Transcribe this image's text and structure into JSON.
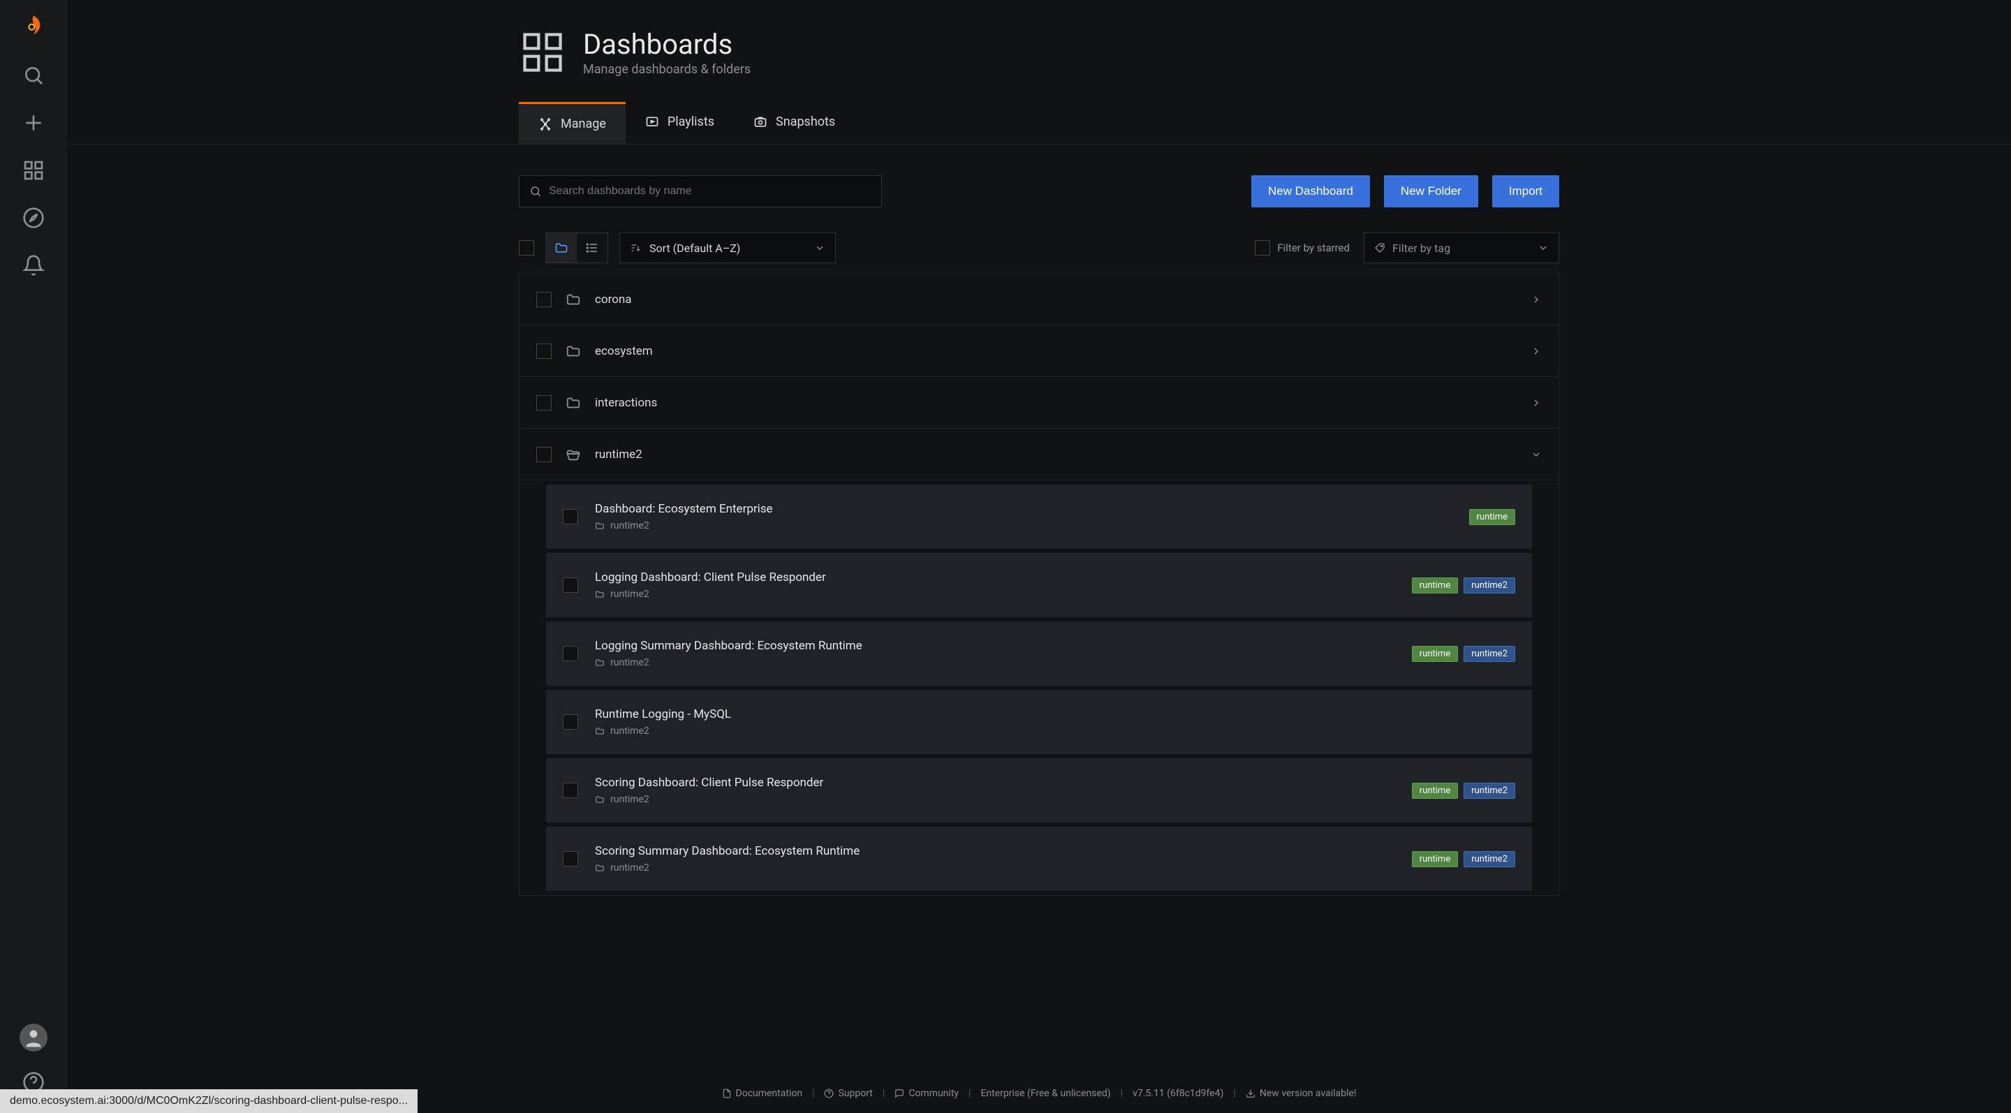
{
  "header": {
    "title": "Dashboards",
    "subtitle": "Manage dashboards & folders"
  },
  "tabs": [
    {
      "label": "Manage",
      "active": true
    },
    {
      "label": "Playlists",
      "active": false
    },
    {
      "label": "Snapshots",
      "active": false
    }
  ],
  "search": {
    "placeholder": "Search dashboards by name"
  },
  "buttons": {
    "new_dashboard": "New Dashboard",
    "new_folder": "New Folder",
    "import": "Import"
  },
  "sort": {
    "label": "Sort (Default A–Z)"
  },
  "starred": {
    "label": "Filter by starred"
  },
  "tag_filter": {
    "placeholder": "Filter by tag"
  },
  "folders": [
    {
      "name": "corona",
      "expanded": false
    },
    {
      "name": "ecosystem",
      "expanded": false
    },
    {
      "name": "interactions",
      "expanded": false
    },
    {
      "name": "runtime2",
      "expanded": true
    }
  ],
  "dashboards": [
    {
      "title": "Dashboard: Ecosystem Enterprise",
      "folder": "runtime2",
      "tags": [
        "runtime"
      ]
    },
    {
      "title": "Logging Dashboard: Client Pulse Responder",
      "folder": "runtime2",
      "tags": [
        "runtime",
        "runtime2"
      ]
    },
    {
      "title": "Logging Summary Dashboard: Ecosystem Runtime",
      "folder": "runtime2",
      "tags": [
        "runtime",
        "runtime2"
      ]
    },
    {
      "title": "Runtime Logging - MySQL",
      "folder": "runtime2",
      "tags": []
    },
    {
      "title": "Scoring Dashboard: Client Pulse Responder",
      "folder": "runtime2",
      "tags": [
        "runtime",
        "runtime2"
      ]
    },
    {
      "title": "Scoring Summary Dashboard: Ecosystem Runtime",
      "folder": "runtime2",
      "tags": [
        "runtime",
        "runtime2"
      ]
    }
  ],
  "footer": {
    "documentation": "Documentation",
    "support": "Support",
    "community": "Community",
    "enterprise": "Enterprise (Free & unlicensed)",
    "version": "v7.5.11 (6f8c1d9fe4)",
    "new_version": "New version available!"
  },
  "url_tip": "demo.ecosystem.ai:3000/d/MC0OmK2Zl/scoring-dashboard-client-pulse-respo..."
}
